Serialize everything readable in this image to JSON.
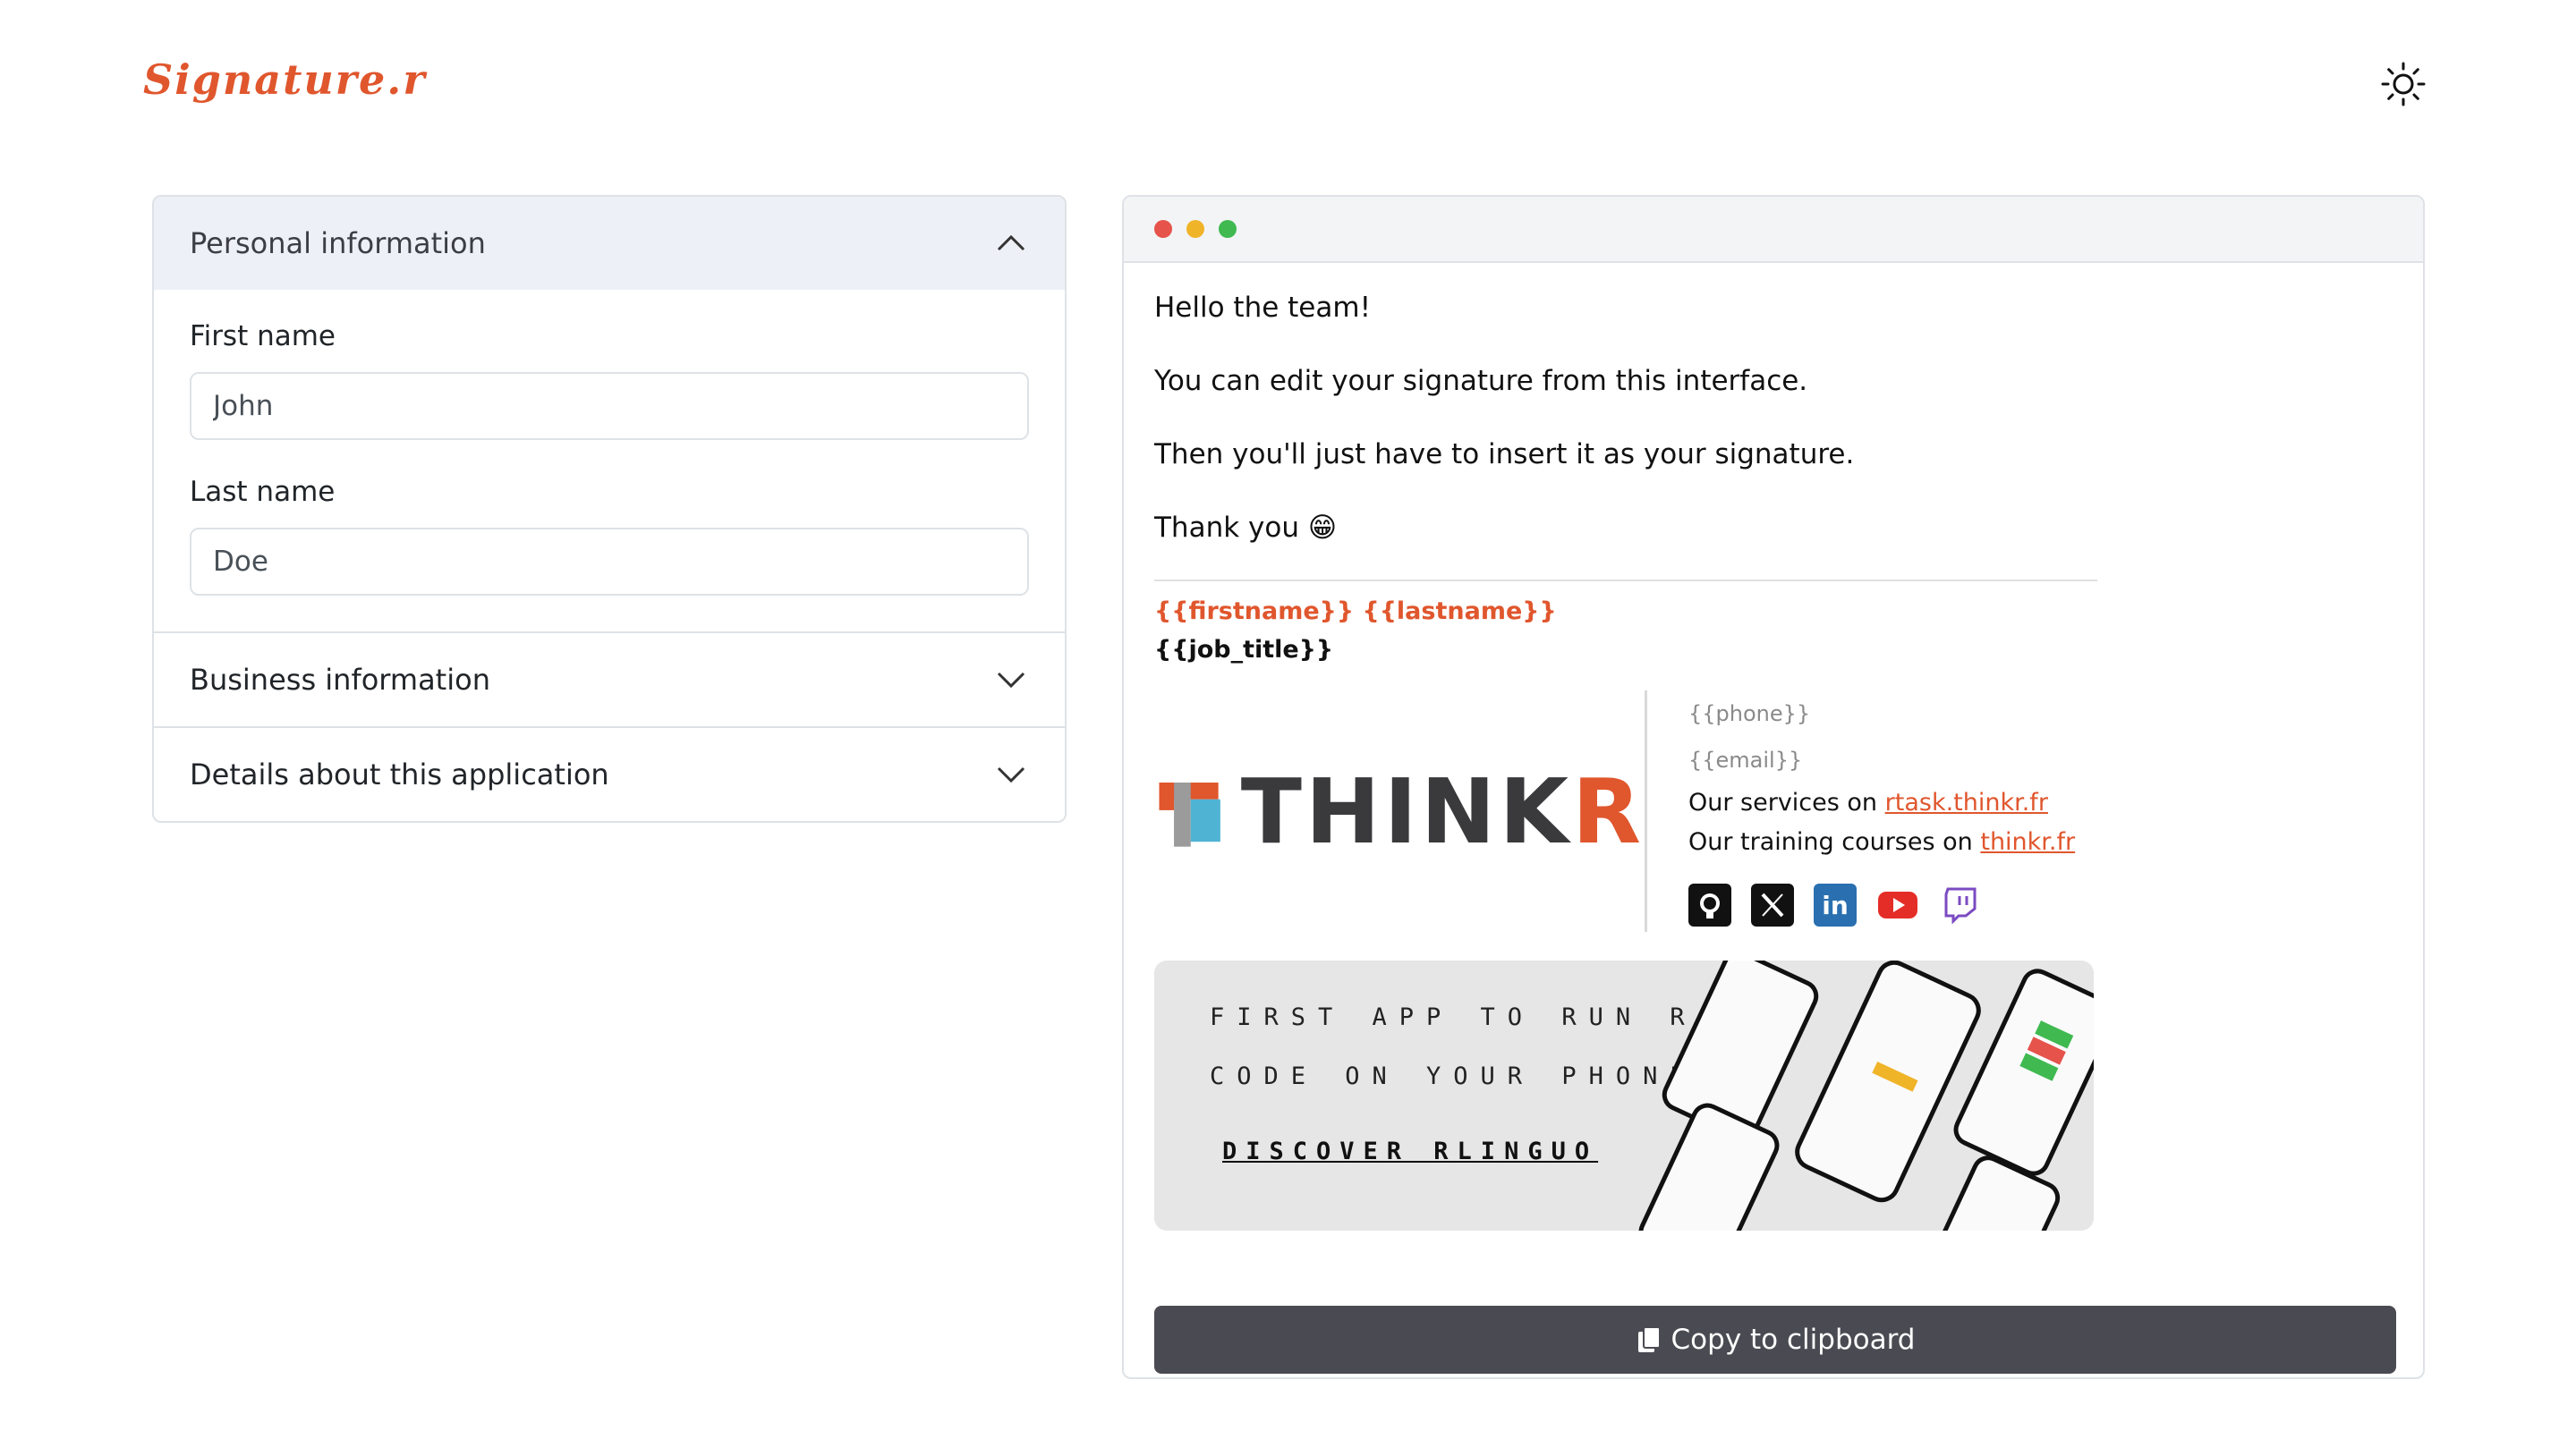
{
  "brand": {
    "logo_text": "Signature.r"
  },
  "accordion": {
    "personal": {
      "title": "Personal information",
      "first_name_label": "First name",
      "first_name_value": "John",
      "last_name_label": "Last name",
      "last_name_value": "Doe"
    },
    "business": {
      "title": "Business information"
    },
    "details": {
      "title": "Details about this application"
    }
  },
  "preview": {
    "window_dots": [
      "#e5534b",
      "#f0b429",
      "#3fb950"
    ],
    "greeting": "Hello the team!",
    "line1": "You can edit your signature from this interface.",
    "line2": "Then you'll just have to insert it as your signature.",
    "thanks": "Thank you",
    "thanks_emoji": "😁",
    "signature": {
      "name_template": "{{firstname}} {{lastname}}",
      "job_template": "{{job_title}}",
      "company_logo": "THINKR",
      "phone_template": "{{phone}}",
      "email_template": "{{email}}",
      "services_label": "Our services on",
      "services_link": "rtask.thinkr.fr",
      "training_label": "Our training courses on",
      "training_link": "thinkr.fr",
      "socials": [
        "github-icon",
        "x-icon",
        "linkedin-icon",
        "youtube-icon",
        "twitch-icon"
      ]
    },
    "banner": {
      "line1": "FIRST APP TO RUN R",
      "line2": "CODE ON YOUR PHONE",
      "cta": "DISCOVER RLINGUO"
    },
    "copy_button": "Copy to clipboard"
  },
  "colors": {
    "accent": "#e0562d",
    "button_bg": "#4a4a52",
    "accordion_open_bg": "#eef0f7"
  }
}
